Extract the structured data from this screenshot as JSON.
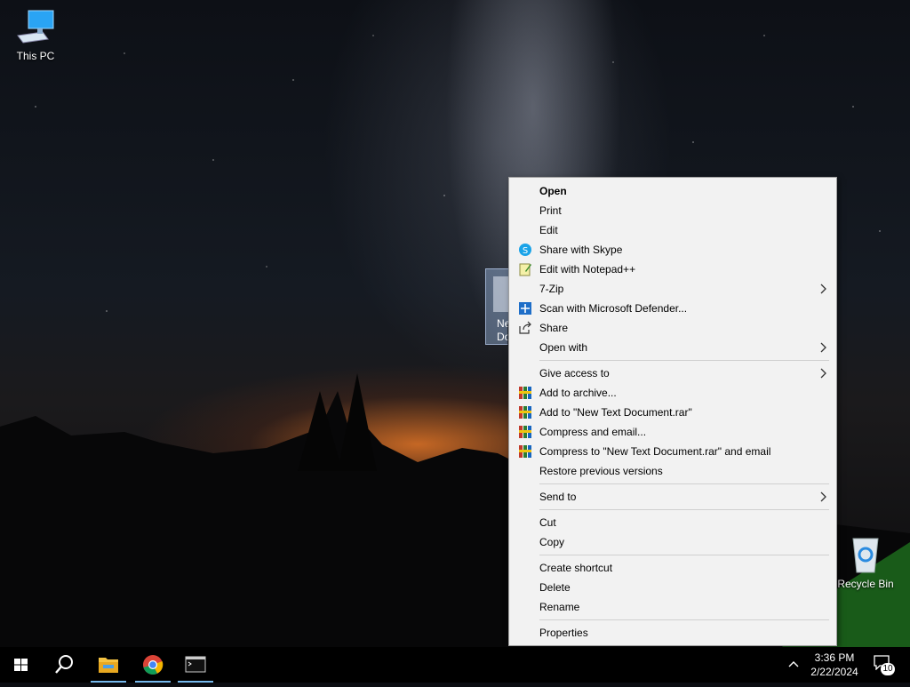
{
  "desktop": {
    "icons": [
      {
        "label": "This PC"
      },
      {
        "label": "Recycle Bin"
      }
    ],
    "selected_file": {
      "label_line1": "Ne",
      "label_line2": "Do"
    }
  },
  "context_menu": {
    "items": [
      {
        "label": "Open",
        "bold": true
      },
      {
        "label": "Print"
      },
      {
        "label": "Edit"
      },
      {
        "label": "Share with Skype",
        "icon": "skype-icon"
      },
      {
        "label": "Edit with Notepad++",
        "icon": "notepadpp-icon"
      },
      {
        "label": "7-Zip",
        "submenu": true
      },
      {
        "label": "Scan with Microsoft Defender...",
        "icon": "defender-icon"
      },
      {
        "label": "Share",
        "icon": "share-icon"
      },
      {
        "label": "Open with",
        "submenu": true
      },
      {
        "label": "Give access to",
        "submenu": true
      },
      {
        "label": "Add to archive...",
        "icon": "winrar-icon"
      },
      {
        "label": "Add to \"New Text Document.rar\"",
        "icon": "winrar-icon"
      },
      {
        "label": "Compress and email...",
        "icon": "winrar-icon"
      },
      {
        "label": "Compress to \"New Text Document.rar\" and email",
        "icon": "winrar-icon"
      },
      {
        "label": "Restore previous versions"
      },
      {
        "label": "Send to",
        "submenu": true
      },
      {
        "label": "Cut"
      },
      {
        "label": "Copy"
      },
      {
        "label": "Create shortcut"
      },
      {
        "label": "Delete"
      },
      {
        "label": "Rename"
      },
      {
        "label": "Properties"
      }
    ]
  },
  "taskbar": {
    "apps": [
      "file-explorer-icon",
      "chrome-icon",
      "terminal-icon"
    ],
    "clock_time": "3:36 PM",
    "clock_date": "2/22/2024",
    "notification_count": "10"
  },
  "colors": {
    "taskbar": "#000000",
    "menu_bg": "#f2f2f2",
    "accent": "#76b9ed"
  }
}
